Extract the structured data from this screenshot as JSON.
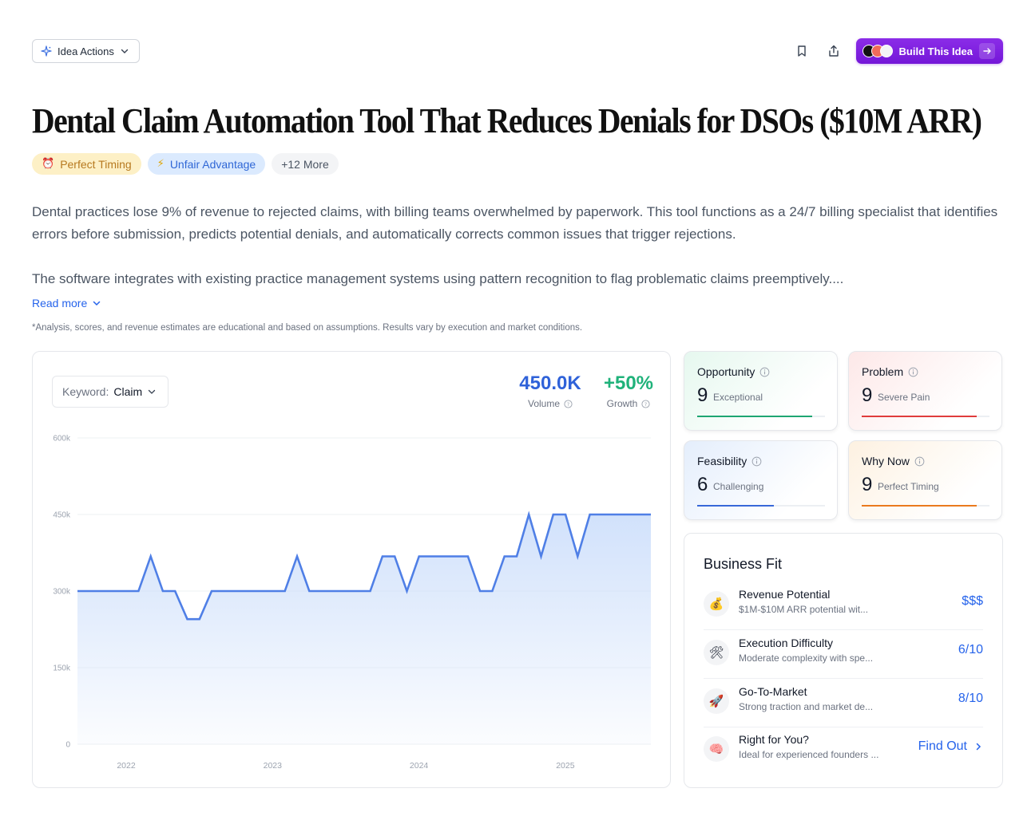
{
  "header": {
    "idea_actions_label": "Idea Actions",
    "build_label": "Build This Idea"
  },
  "title": "Dental Claim Automation Tool That Reduces Denials for DSOs ($10M ARR)",
  "tags": {
    "timing": "Perfect Timing",
    "advantage": "Unfair Advantage",
    "more": "+12 More"
  },
  "description": {
    "p1": "Dental practices lose 9% of revenue to rejected claims, with billing teams overwhelmed by paperwork. This tool functions as a 24/7 billing specialist that identifies errors before submission, predicts potential denials, and automatically corrects common issues that trigger rejections.",
    "p2": "The software integrates with existing practice management systems using pattern recognition to flag problematic claims preemptively....",
    "read_more": "Read more"
  },
  "disclaimer": "*Analysis, scores, and revenue estimates are educational and based on assumptions. Results vary by execution and market conditions.",
  "keyword": {
    "label": "Keyword:",
    "value": "Claim"
  },
  "metrics": {
    "volume": {
      "value": "450.0K",
      "label": "Volume"
    },
    "growth": {
      "value": "+50%",
      "label": "Growth"
    }
  },
  "chart_data": {
    "type": "area",
    "x_ticks": [
      "2022",
      "2023",
      "2024",
      "2025"
    ],
    "y_ticks": [
      "0",
      "150k",
      "300k",
      "450k",
      "600k"
    ],
    "ylim": [
      0,
      600000
    ],
    "grid": true,
    "series": [
      {
        "values": [
          300000,
          300000,
          300000,
          300000,
          300000,
          300000,
          368000,
          300000,
          300000,
          245000,
          245000,
          300000,
          300000,
          300000,
          300000,
          300000,
          300000,
          300000,
          368000,
          300000,
          300000,
          300000,
          300000,
          300000,
          300000,
          368000,
          368000,
          300000,
          368000,
          368000,
          368000,
          368000,
          368000,
          300000,
          300000,
          368000,
          368000,
          450000,
          368000,
          450000,
          450000,
          368000,
          450000,
          450000,
          450000,
          450000,
          450000,
          450000
        ]
      }
    ],
    "colors": {
      "line": "#4f7fe6",
      "fill": "#cfe0fb"
    }
  },
  "scores": [
    {
      "label": "Opportunity",
      "value": "9",
      "desc": "Exceptional",
      "level": 0.9,
      "color": "#1ea672"
    },
    {
      "label": "Problem",
      "value": "9",
      "desc": "Severe Pain",
      "level": 0.9,
      "color": "#e03c3c"
    },
    {
      "label": "Feasibility",
      "value": "6",
      "desc": "Challenging",
      "level": 0.6,
      "color": "#3868d8"
    },
    {
      "label": "Why Now",
      "value": "9",
      "desc": "Perfect Timing",
      "level": 0.9,
      "color": "#ea7a1e"
    }
  ],
  "business_fit": {
    "title": "Business Fit",
    "rows": [
      {
        "icon": "money-bag-icon",
        "glyph": "💰",
        "name": "Revenue Potential",
        "sub": "$1M-$10M ARR potential wit...",
        "value": "$$$"
      },
      {
        "icon": "tools-icon",
        "glyph": "🛠",
        "name": "Execution Difficulty",
        "sub": "Moderate complexity with spe...",
        "value": "6/10"
      },
      {
        "icon": "rocket-icon",
        "glyph": "🚀",
        "name": "Go-To-Market",
        "sub": "Strong traction and market de...",
        "value": "8/10"
      },
      {
        "icon": "brain-icon",
        "glyph": "🧠",
        "name": "Right for You?",
        "sub": "Ideal for experienced founders ...",
        "value": "Find Out"
      }
    ]
  }
}
